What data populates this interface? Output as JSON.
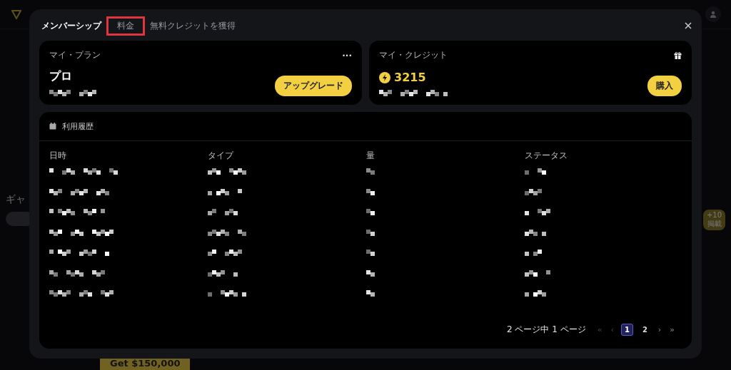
{
  "background": {
    "section_title": "ギャ",
    "badge": {
      "count": "+10",
      "label": "掲載"
    },
    "promo_button": "Get $150,000"
  },
  "dialog": {
    "tabs": [
      {
        "label": "メンバーシップ",
        "selected": true,
        "annotated": false
      },
      {
        "label": "料金",
        "selected": false,
        "annotated": true
      },
      {
        "label": "無料クレジットを獲得",
        "selected": false,
        "annotated": false
      }
    ],
    "plan": {
      "title": "マイ・プラン",
      "menu": "···",
      "name": "プロ",
      "button": "アップグレード"
    },
    "credits": {
      "title": "マイ・クレジット",
      "amount": "3215",
      "button": "購入"
    },
    "history": {
      "title": "利用履歴",
      "columns": [
        "日時",
        "タイプ",
        "量",
        "ステータス"
      ],
      "rows": [
        {
          "kind": "redacted"
        },
        {
          "kind": "redacted"
        },
        {
          "kind": "redacted"
        },
        {
          "kind": "redacted"
        },
        {
          "kind": "redacted"
        },
        {
          "kind": "redacted"
        },
        {
          "kind": "redacted"
        }
      ],
      "pagination": {
        "summary": "2 ページ中 1 ページ",
        "first": "«",
        "prev": "‹",
        "pages": [
          {
            "label": "1",
            "selected": true
          },
          {
            "label": "2",
            "selected": false
          }
        ],
        "next": "›",
        "last": "»"
      }
    }
  }
}
